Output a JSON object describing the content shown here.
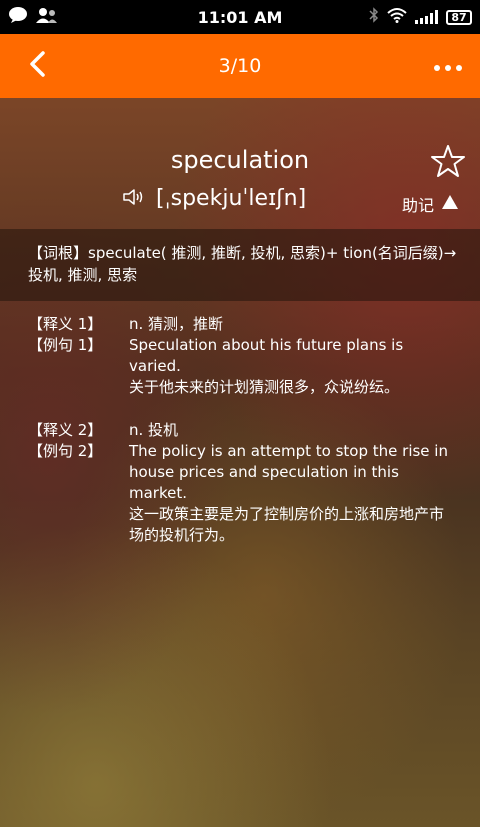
{
  "status_bar": {
    "time": "11:01 AM",
    "battery": "87"
  },
  "header": {
    "title": "3/10"
  },
  "word": {
    "text": "speculation",
    "pronunciation": "[ˌspekjuˈleɪʃn]",
    "mnemonic_label": "助记"
  },
  "root": {
    "label": "【词根】",
    "text": "speculate( 推测, 推断, 投机, 思索)+ tion(名词后缀)→投机, 推测, 思索"
  },
  "definitions": [
    {
      "meaning_label": "【释义 1】",
      "meaning": "n. 猜测，推断",
      "example_label": "【例句 1】",
      "example_en": "Speculation about his future plans is varied.",
      "example_cn": "关于他未来的计划猜测很多，众说纷纭。"
    },
    {
      "meaning_label": "【释义 2】",
      "meaning": "n. 投机",
      "example_label": "【例句 2】",
      "example_en": "The policy is an attempt to stop the rise in house prices and speculation in this market.",
      "example_cn": "这一政策主要是为了控制房价的上涨和房地产市场的投机行为。"
    }
  ],
  "colors": {
    "header": "#ff6a00",
    "status_bar": "#000000",
    "text": "#ffffff"
  },
  "icons": {
    "back": "back-arrow-icon",
    "more": "more-dots-icon",
    "star": "star-icon",
    "speaker": "speaker-icon",
    "triangle": "triangle-up-icon"
  }
}
